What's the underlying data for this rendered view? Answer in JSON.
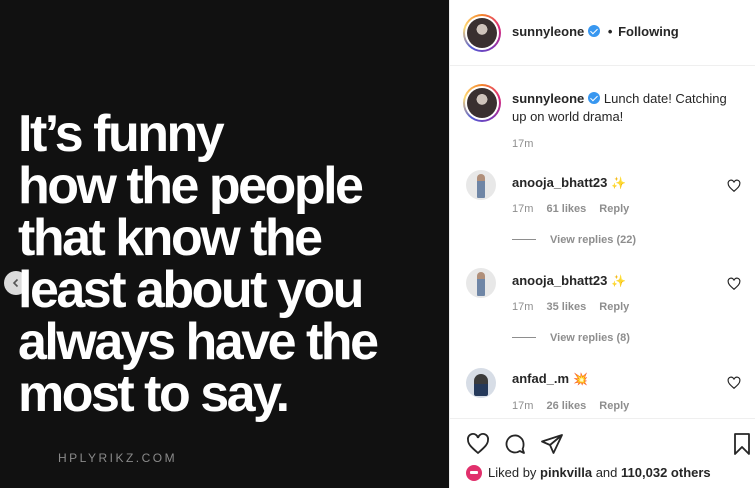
{
  "post_image": {
    "quote_lines": [
      "It’s funny",
      "how the people",
      "that know the",
      "least about you",
      "always have the",
      "most to say."
    ],
    "watermark": "HPLYRIKZ.COM"
  },
  "header": {
    "username": "sunnyleone",
    "separator": "•",
    "follow_label": "Following"
  },
  "caption": {
    "username": "sunnyleone",
    "text": "Lunch date! Catching up on world drama!",
    "time": "17m"
  },
  "comments": [
    {
      "username": "anooja_bhatt23",
      "emoji": "✨",
      "time": "17m",
      "likes": "61 likes",
      "reply_label": "Reply",
      "view_replies": "View replies (22)"
    },
    {
      "username": "anooja_bhatt23",
      "emoji": "✨",
      "time": "17m",
      "likes": "35 likes",
      "reply_label": "Reply",
      "view_replies": "View replies (8)"
    },
    {
      "username": "anfad_.m",
      "emoji": "💥",
      "time": "17m",
      "likes": "26 likes",
      "reply_label": "Reply"
    }
  ],
  "likes": {
    "prefix": "Liked by",
    "by_user": "pinkvilla",
    "connector": "and",
    "others": "110,032 others"
  },
  "colors": {
    "verified": "#3897f0",
    "secondary_text": "#8e8e8e",
    "image_bg": "#111111"
  },
  "icons": {
    "prev": "chevron-left-icon",
    "like": "heart-icon",
    "comment": "comment-icon",
    "share": "paper-plane-icon",
    "save": "bookmark-icon"
  }
}
